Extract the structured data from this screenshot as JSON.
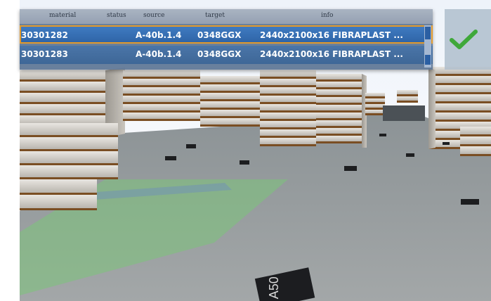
{
  "table": {
    "columns": [
      "material",
      "status",
      "source",
      "target",
      "info"
    ],
    "rows": [
      {
        "material": "30301282",
        "status": "",
        "source": "A-40b.1.4",
        "target": "0348GGX",
        "info": "2440x2100x16 FIBRAPLAST ...",
        "selected": true
      },
      {
        "material": "30301283",
        "status": "",
        "source": "A-40b.1.4",
        "target": "0348GGX",
        "info": "2440x2100x16 FIBRAPLAST ...",
        "selected": false
      }
    ]
  },
  "confirm_icon": "check-icon",
  "floor_marker_text": "A50",
  "colors": {
    "selected_row": "#3a74b8",
    "row": "#4670a2",
    "selection_border": "#e29a2c",
    "check": "#3fa83a",
    "floor_zone": "#7cc57a"
  }
}
